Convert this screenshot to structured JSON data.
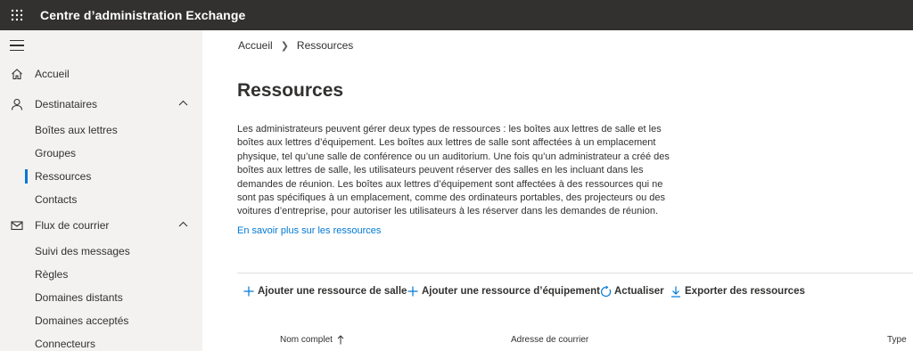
{
  "header": {
    "title": "Centre d’administration Exchange",
    "waffle_icon": "waffle-icon"
  },
  "sidebar": {
    "menu_icon": "hamburger-icon",
    "home": {
      "label": "Accueil",
      "icon": "home-icon"
    },
    "recipients": {
      "label": "Destinataires",
      "icon": "person-icon",
      "items": [
        "Boîtes aux lettres",
        "Groupes",
        "Ressources",
        "Contacts"
      ]
    },
    "mailflow": {
      "label": "Flux de courrier",
      "icon": "mail-icon",
      "items": [
        "Suivi des messages",
        "Règles",
        "Domaines distants",
        "Domaines acceptés",
        "Connecteurs"
      ]
    }
  },
  "main": {
    "breadcrumb": {
      "home": "Accueil",
      "current": "Ressources"
    },
    "title": "Ressources",
    "description": "Les administrateurs peuvent gérer deux types de ressources : les boîtes aux lettres de salle et les boîtes aux lettres d’équipement. Les boîtes aux lettres de salle sont affectées à un emplacement physique, tel qu’une salle de conférence ou un auditorium. Une fois qu’un administrateur a créé des boîtes aux lettres de salle, les utilisateurs peuvent réserver des salles en les incluant dans les demandes de réunion. Les boîtes aux lettres d’équipement sont affectées à des ressources qui ne sont pas spécifiques à un emplacement, comme des ordinateurs portables, des projecteurs ou des voitures d’entreprise, pour autoriser les utilisateurs à les réserver dans les demandes de réunion.",
    "learn_more": "En savoir plus sur les ressources",
    "commands": {
      "add_room": "Ajouter une ressource de salle",
      "add_equipment": "Ajouter une ressource d’équipement",
      "refresh": "Actualiser",
      "export": "Exporter des ressources"
    },
    "columns": {
      "name": "Nom complet",
      "sort_icon": "arrow-up-icon",
      "email": "Adresse de courrier",
      "type": "Type"
    }
  },
  "colors": {
    "topbar": "#323130",
    "sidebar": "#f3f2f1",
    "accent": "#0078d4"
  }
}
